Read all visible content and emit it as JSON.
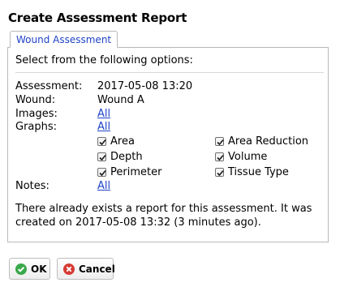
{
  "dialog": {
    "title": "Create Assessment Report",
    "tab_label": "Wound Assessment",
    "intro": "Select from the following options:"
  },
  "fields": {
    "assessment": {
      "label": "Assessment:",
      "value": "2017-05-08 13:20"
    },
    "wound": {
      "label": "Wound:",
      "value": "Wound A"
    },
    "images": {
      "label": "Images:",
      "link": "All"
    },
    "graphs": {
      "label": "Graphs:",
      "link": "All"
    },
    "notes": {
      "label": "Notes:",
      "link": "All"
    }
  },
  "graph_options": [
    {
      "label": "Area",
      "checked": true
    },
    {
      "label": "Area Reduction",
      "checked": true
    },
    {
      "label": "Depth",
      "checked": true
    },
    {
      "label": "Volume",
      "checked": true
    },
    {
      "label": "Perimeter",
      "checked": true
    },
    {
      "label": "Tissue Type",
      "checked": true
    }
  ],
  "message": "There already exists a report for this assessment. It was created on 2017-05-08 13:32 (3 minutes ago).",
  "buttons": {
    "ok_label": "OK",
    "cancel_label": "Cancel"
  },
  "colors": {
    "link": "#1f43c8",
    "ok_icon": "#39a84a",
    "cancel_icon": "#d63a33"
  },
  "icons": {
    "ok": "check-circle-icon",
    "cancel": "x-circle-icon",
    "checkbox": "checkmark-icon"
  }
}
